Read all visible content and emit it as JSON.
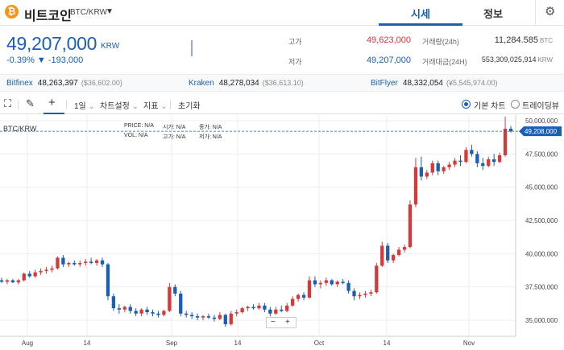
{
  "header": {
    "coin_icon": "bitcoin-icon",
    "coin_symbol": "₿",
    "coin_name": "비트코인",
    "pair": "BTC/KRW",
    "tabs": [
      {
        "label": "시세",
        "active": true
      },
      {
        "label": "정보",
        "active": false
      }
    ],
    "settings_icon": "gear-icon"
  },
  "ticker": {
    "price": "49,207,000",
    "unit": "KRW",
    "change": "-0.39% ▼ -193,000",
    "high_label": "고가",
    "high": "49,623,000",
    "low_label": "저가",
    "low": "49,207,000",
    "volume_label": "거래량(24h)",
    "volume": "11,284.585",
    "volume_unit": "BTC",
    "amount_label": "거래대금(24H)",
    "amount": "553,309,025,914",
    "amount_unit": "KRW"
  },
  "exchanges": [
    {
      "name": "Bitfinex",
      "value": "48,263,397",
      "sub": "($36,602.00)"
    },
    {
      "name": "Kraken",
      "value": "48,278,034",
      "sub": "($36,613.10)"
    },
    {
      "name": "BitFlyer",
      "value": "48,332,054",
      "sub": "(¥5,545,974.00)"
    }
  ],
  "toolbar": {
    "interval": "1일",
    "chart_settings": "차트설정",
    "indicators": "지표",
    "reset": "초기화",
    "basic_chart": "기본 차트",
    "tradingview": "트레이딩뷰"
  },
  "legend": {
    "price": "PRICE:",
    "price_v": "N/A",
    "open": "시가:",
    "open_v": "N/A",
    "close": "종가:",
    "close_v": "N/A",
    "vol": "VOL:",
    "vol_v": "N/A",
    "high": "고가:",
    "high_v": "N/A",
    "low": "저가:",
    "low_v": "N/A"
  },
  "chart_pair": "BTC/KRW",
  "current_price_tag": "49,208,000",
  "zoom": {
    "minus": "−",
    "plus": "+"
  },
  "colors": {
    "up": "#d23b3b",
    "down": "#1a5fb4",
    "accent": "#1a5fb4"
  },
  "chart_data": {
    "type": "candlestick",
    "y_ticks": [
      "50,000,000",
      "47,500,000",
      "45,000,000",
      "42,500,000",
      "40,000,000",
      "37,500,000",
      "35,000,000"
    ],
    "y_tick_values": [
      50000000,
      47500000,
      45000000,
      42500000,
      40000000,
      37500000,
      35000000
    ],
    "x_ticks": [
      "Aug",
      "14",
      "Sep",
      "14",
      "Oct",
      "14",
      "Nov"
    ],
    "candles": [
      [
        38000000,
        38200000,
        37800000,
        37900000
      ],
      [
        37900000,
        38100000,
        37700000,
        38000000
      ],
      [
        38000000,
        38100000,
        37800000,
        37850000
      ],
      [
        37850000,
        38100000,
        37700000,
        38000000
      ],
      [
        38000000,
        38600000,
        37900000,
        38500000
      ],
      [
        38500000,
        38700000,
        38200000,
        38300000
      ],
      [
        38300000,
        38800000,
        38200000,
        38600000
      ],
      [
        38600000,
        38900000,
        38400000,
        38700000
      ],
      [
        38700000,
        39000000,
        38500000,
        38800000
      ],
      [
        38800000,
        39100000,
        38600000,
        38900000
      ],
      [
        38900000,
        39800000,
        38800000,
        39700000
      ],
      [
        39700000,
        39900000,
        39000000,
        39200000
      ],
      [
        39200000,
        39400000,
        39000000,
        39300000
      ],
      [
        39300000,
        39500000,
        39100000,
        39200000
      ],
      [
        39200000,
        39500000,
        39000000,
        39300000
      ],
      [
        39300000,
        39600000,
        39100000,
        39400000
      ],
      [
        39400000,
        39700000,
        39200000,
        39300000
      ],
      [
        39300000,
        39600000,
        39100000,
        39500000
      ],
      [
        39500000,
        39700000,
        39000000,
        39200000
      ],
      [
        39200000,
        39300000,
        36500000,
        36800000
      ],
      [
        36800000,
        37000000,
        35700000,
        35900000
      ],
      [
        35900000,
        36200000,
        35500000,
        35800000
      ],
      [
        35800000,
        36100000,
        35600000,
        36000000
      ],
      [
        36000000,
        36200000,
        35500000,
        35700000
      ],
      [
        35700000,
        35900000,
        35300000,
        35500000
      ],
      [
        35500000,
        35900000,
        35300000,
        35800000
      ],
      [
        35800000,
        36000000,
        35400000,
        35600000
      ],
      [
        35600000,
        35800000,
        35300000,
        35500000
      ],
      [
        35500000,
        35700000,
        35200000,
        35400000
      ],
      [
        35400000,
        35800000,
        35300000,
        35700000
      ],
      [
        35700000,
        37800000,
        35600000,
        37500000
      ],
      [
        37500000,
        37700000,
        36800000,
        37000000
      ],
      [
        37000000,
        37200000,
        35300000,
        35500000
      ],
      [
        35500000,
        35700000,
        35200000,
        35400000
      ],
      [
        35400000,
        35600000,
        35100000,
        35300000
      ],
      [
        35300000,
        35500000,
        35000000,
        35200000
      ],
      [
        35200000,
        35400000,
        35000000,
        35300000
      ],
      [
        35300000,
        35500000,
        35100000,
        35200000
      ],
      [
        35200000,
        35400000,
        34900000,
        35100000
      ],
      [
        35100000,
        35600000,
        35000000,
        35400000
      ],
      [
        35400000,
        35500000,
        34500000,
        34700000
      ],
      [
        34700000,
        35700000,
        34600000,
        35500000
      ],
      [
        35500000,
        35800000,
        35300000,
        35600000
      ],
      [
        35600000,
        36000000,
        35500000,
        35900000
      ],
      [
        35900000,
        36100000,
        35700000,
        36000000
      ],
      [
        36000000,
        36200000,
        35800000,
        35900000
      ],
      [
        35900000,
        36300000,
        35800000,
        36100000
      ],
      [
        36100000,
        36300000,
        35600000,
        35800000
      ],
      [
        35800000,
        36000000,
        35300000,
        35500000
      ],
      [
        35500000,
        36000000,
        35400000,
        35800000
      ],
      [
        35800000,
        36100000,
        35600000,
        35700000
      ],
      [
        35700000,
        36300000,
        35600000,
        36100000
      ],
      [
        36100000,
        36800000,
        36000000,
        36600000
      ],
      [
        36600000,
        37000000,
        36400000,
        36900000
      ],
      [
        36900000,
        37100000,
        36500000,
        36700000
      ],
      [
        36700000,
        38300000,
        36600000,
        38000000
      ],
      [
        38000000,
        38300000,
        37500000,
        37700000
      ],
      [
        37700000,
        38000000,
        37400000,
        37800000
      ],
      [
        37800000,
        38200000,
        37600000,
        38000000
      ],
      [
        38000000,
        38100000,
        37600000,
        37700000
      ],
      [
        37700000,
        38000000,
        37500000,
        37900000
      ],
      [
        37900000,
        38100000,
        37700000,
        37800000
      ],
      [
        37800000,
        38000000,
        37000000,
        37200000
      ],
      [
        37200000,
        37400000,
        36500000,
        36800000
      ],
      [
        36800000,
        37100000,
        36600000,
        36900000
      ],
      [
        36900000,
        37200000,
        36700000,
        37000000
      ],
      [
        37000000,
        37300000,
        36800000,
        37100000
      ],
      [
        37100000,
        39300000,
        37000000,
        39100000
      ],
      [
        39100000,
        40900000,
        39000000,
        40600000
      ],
      [
        40600000,
        40800000,
        39300000,
        39500000
      ],
      [
        39500000,
        40000000,
        39300000,
        39900000
      ],
      [
        39900000,
        40500000,
        39800000,
        40300000
      ],
      [
        40300000,
        40700000,
        40100000,
        40500000
      ],
      [
        40500000,
        44000000,
        40400000,
        43700000
      ],
      [
        43700000,
        47200000,
        43500000,
        46500000
      ],
      [
        46500000,
        47300000,
        45500000,
        45800000
      ],
      [
        45800000,
        46300000,
        45600000,
        46100000
      ],
      [
        46100000,
        47000000,
        45900000,
        46800000
      ],
      [
        46800000,
        47000000,
        45900000,
        46200000
      ],
      [
        46200000,
        46600000,
        46000000,
        46500000
      ],
      [
        46500000,
        46900000,
        46300000,
        46700000
      ],
      [
        46700000,
        47200000,
        46500000,
        47000000
      ],
      [
        47000000,
        47400000,
        46600000,
        46900000
      ],
      [
        46900000,
        48000000,
        46800000,
        47800000
      ],
      [
        47800000,
        48200000,
        47300000,
        47500000
      ],
      [
        47500000,
        47700000,
        46500000,
        46800000
      ],
      [
        46800000,
        47200000,
        46300000,
        46600000
      ],
      [
        46600000,
        47300000,
        46500000,
        47100000
      ],
      [
        47100000,
        47500000,
        46600000,
        46900000
      ],
      [
        46900000,
        47600000,
        46800000,
        47400000
      ],
      [
        47400000,
        50300000,
        47300000,
        49400000
      ],
      [
        49400000,
        49600000,
        49100000,
        49207000
      ]
    ]
  }
}
